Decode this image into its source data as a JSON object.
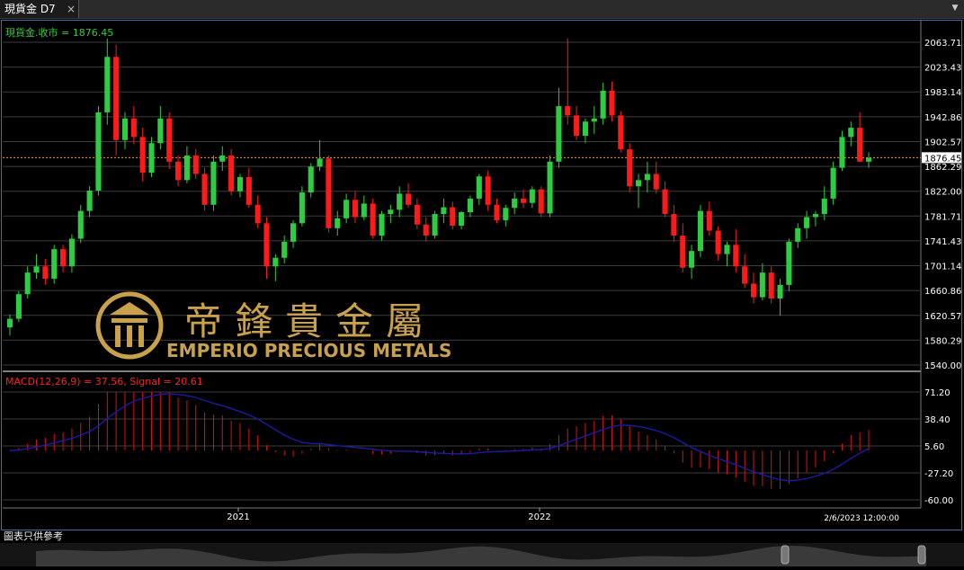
{
  "tab": {
    "title": "現貨金 D7",
    "close": "×"
  },
  "colors": {
    "up": "#2ecc40",
    "down": "#ff1a1a",
    "grid": "#3c3c3c",
    "axis_text": "#ffffff",
    "price_line": "#ff9900",
    "signal": "#1a1aa8",
    "legend_price": "#33cc33",
    "legend_macd": "#ff2020",
    "logo_gold": "#c9a14a"
  },
  "price_panel": {
    "legend": "現貨金.收市 = 1876.45",
    "current_price": "1876.45",
    "y_ticks": [
      "2063.71",
      "2023.43",
      "1983.14",
      "1942.86",
      "1902.57",
      "1862.29",
      "1822.00",
      "1781.71",
      "1741.43",
      "1701.14",
      "1660.86",
      "1620.57",
      "1580.29",
      "1540.00"
    ]
  },
  "macd_panel": {
    "legend": "MACD(12,26,9) = 37.56, Signal = 20.61",
    "y_ticks": [
      "71.20",
      "38.40",
      "5.60",
      "-27.20",
      "-60.00"
    ]
  },
  "x_axis": {
    "labels": [
      "2021",
      "2022"
    ],
    "last_label": "2/6/2023 12:00:00"
  },
  "watermark": {
    "chinese": "帝鋒貴金屬",
    "english": "EMPERIO PRECIOUS METALS"
  },
  "disclaimer": "圖表只供參考",
  "chart_data": {
    "type": "candlestick",
    "instrument": "現貨金",
    "timeframe": "D7",
    "last_close": 1876.45,
    "ylim_price": [
      1540.0,
      2063.71
    ],
    "ylim_macd": [
      -60.0,
      71.2
    ],
    "macd_last": 37.56,
    "signal_last": 20.61,
    "candles": [
      [
        1601,
        1622,
        1588,
        1615
      ],
      [
        1615,
        1660,
        1610,
        1655
      ],
      [
        1655,
        1700,
        1648,
        1690
      ],
      [
        1690,
        1720,
        1680,
        1700
      ],
      [
        1700,
        1712,
        1670,
        1680
      ],
      [
        1680,
        1735,
        1672,
        1728
      ],
      [
        1728,
        1735,
        1690,
        1700
      ],
      [
        1700,
        1752,
        1690,
        1745
      ],
      [
        1745,
        1800,
        1738,
        1790
      ],
      [
        1790,
        1830,
        1780,
        1823
      ],
      [
        1823,
        1960,
        1815,
        1950
      ],
      [
        1950,
        2070,
        1930,
        2040
      ],
      [
        2040,
        2060,
        1880,
        1905
      ],
      [
        1905,
        1950,
        1890,
        1940
      ],
      [
        1940,
        1960,
        1898,
        1910
      ],
      [
        1910,
        1925,
        1838,
        1852
      ],
      [
        1852,
        1910,
        1845,
        1900
      ],
      [
        1900,
        1960,
        1890,
        1940
      ],
      [
        1940,
        1950,
        1858,
        1870
      ],
      [
        1870,
        1880,
        1830,
        1840
      ],
      [
        1840,
        1895,
        1835,
        1880
      ],
      [
        1880,
        1890,
        1842,
        1850
      ],
      [
        1850,
        1860,
        1790,
        1800
      ],
      [
        1800,
        1880,
        1790,
        1870
      ],
      [
        1870,
        1895,
        1855,
        1880
      ],
      [
        1880,
        1890,
        1815,
        1822
      ],
      [
        1822,
        1850,
        1812,
        1845
      ],
      [
        1845,
        1860,
        1795,
        1800
      ],
      [
        1800,
        1815,
        1762,
        1770
      ],
      [
        1770,
        1780,
        1680,
        1700
      ],
      [
        1700,
        1720,
        1676,
        1714
      ],
      [
        1714,
        1750,
        1705,
        1740
      ],
      [
        1740,
        1775,
        1730,
        1770
      ],
      [
        1770,
        1830,
        1765,
        1820
      ],
      [
        1820,
        1868,
        1812,
        1862
      ],
      [
        1862,
        1905,
        1855,
        1875
      ],
      [
        1875,
        1880,
        1755,
        1762
      ],
      [
        1762,
        1790,
        1750,
        1778
      ],
      [
        1778,
        1818,
        1770,
        1808
      ],
      [
        1808,
        1822,
        1770,
        1780
      ],
      [
        1780,
        1815,
        1775,
        1802
      ],
      [
        1802,
        1810,
        1745,
        1750
      ],
      [
        1750,
        1790,
        1742,
        1785
      ],
      [
        1785,
        1800,
        1770,
        1792
      ],
      [
        1792,
        1830,
        1780,
        1818
      ],
      [
        1818,
        1835,
        1795,
        1800
      ],
      [
        1800,
        1810,
        1760,
        1768
      ],
      [
        1768,
        1780,
        1740,
        1750
      ],
      [
        1750,
        1790,
        1745,
        1785
      ],
      [
        1785,
        1810,
        1770,
        1796
      ],
      [
        1796,
        1805,
        1760,
        1766
      ],
      [
        1766,
        1790,
        1760,
        1788
      ],
      [
        1788,
        1815,
        1780,
        1810
      ],
      [
        1810,
        1850,
        1800,
        1846
      ],
      [
        1846,
        1855,
        1790,
        1800
      ],
      [
        1800,
        1810,
        1770,
        1775
      ],
      [
        1775,
        1800,
        1765,
        1795
      ],
      [
        1795,
        1820,
        1785,
        1810
      ],
      [
        1810,
        1825,
        1795,
        1803
      ],
      [
        1803,
        1830,
        1795,
        1825
      ],
      [
        1825,
        1830,
        1780,
        1786
      ],
      [
        1786,
        1880,
        1780,
        1870
      ],
      [
        1870,
        1990,
        1860,
        1960
      ],
      [
        1960,
        2070,
        1930,
        1945
      ],
      [
        1945,
        1960,
        1905,
        1912
      ],
      [
        1912,
        1940,
        1900,
        1935
      ],
      [
        1935,
        1960,
        1915,
        1940
      ],
      [
        1940,
        1998,
        1930,
        1985
      ],
      [
        1985,
        2000,
        1935,
        1945
      ],
      [
        1945,
        1952,
        1885,
        1890
      ],
      [
        1890,
        1900,
        1820,
        1830
      ],
      [
        1830,
        1850,
        1795,
        1840
      ],
      [
        1840,
        1870,
        1820,
        1850
      ],
      [
        1850,
        1870,
        1818,
        1825
      ],
      [
        1825,
        1838,
        1780,
        1785
      ],
      [
        1785,
        1800,
        1740,
        1750
      ],
      [
        1750,
        1770,
        1690,
        1698
      ],
      [
        1698,
        1735,
        1680,
        1725
      ],
      [
        1725,
        1800,
        1715,
        1790
      ],
      [
        1790,
        1805,
        1750,
        1758
      ],
      [
        1758,
        1765,
        1710,
        1720
      ],
      [
        1720,
        1740,
        1700,
        1735
      ],
      [
        1735,
        1760,
        1690,
        1700
      ],
      [
        1700,
        1720,
        1665,
        1672
      ],
      [
        1672,
        1690,
        1640,
        1650
      ],
      [
        1650,
        1705,
        1645,
        1690
      ],
      [
        1690,
        1700,
        1640,
        1648
      ],
      [
        1648,
        1680,
        1620,
        1670
      ],
      [
        1670,
        1745,
        1660,
        1740
      ],
      [
        1740,
        1770,
        1730,
        1762
      ],
      [
        1762,
        1790,
        1745,
        1780
      ],
      [
        1780,
        1790,
        1765,
        1785
      ],
      [
        1785,
        1830,
        1775,
        1810
      ],
      [
        1810,
        1870,
        1800,
        1860
      ],
      [
        1860,
        1920,
        1855,
        1910
      ],
      [
        1910,
        1935,
        1895,
        1925
      ],
      [
        1925,
        1950,
        1870,
        1870
      ],
      [
        1870,
        1885,
        1860,
        1876
      ]
    ]
  }
}
